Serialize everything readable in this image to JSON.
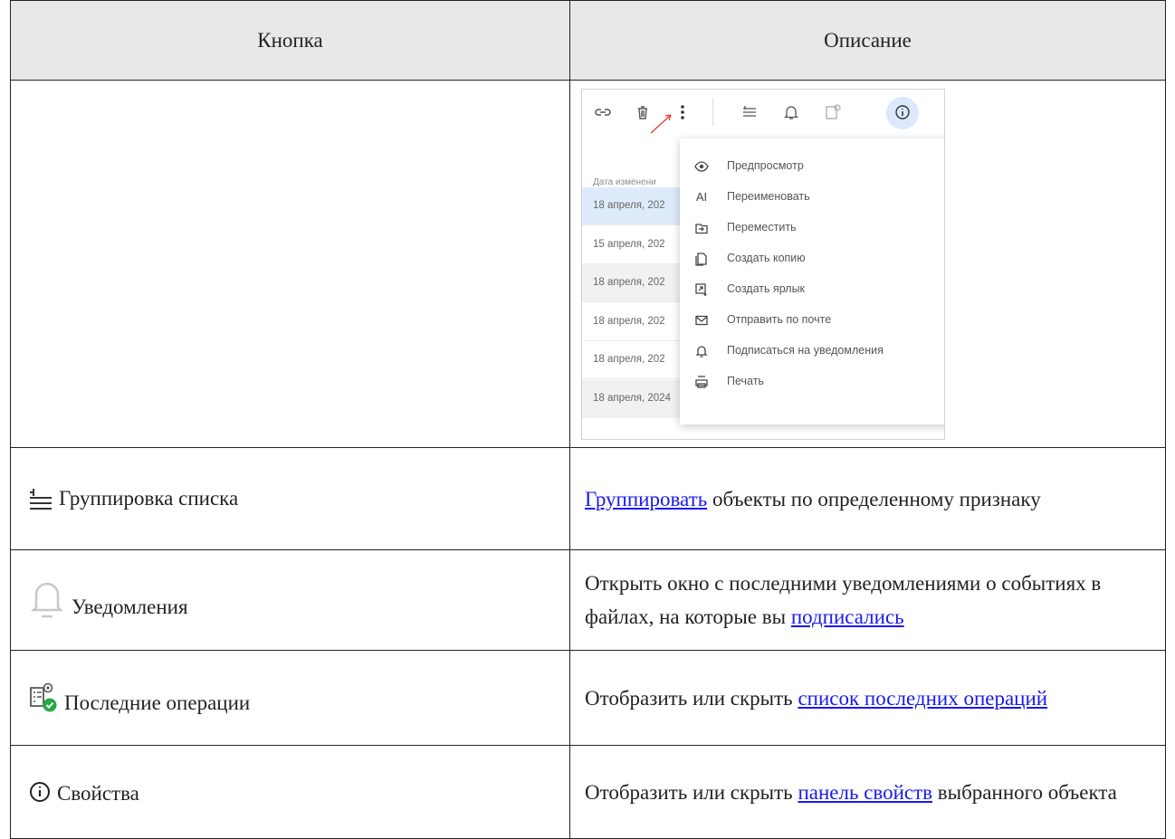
{
  "table": {
    "headers": [
      "Кнопка",
      "Описание"
    ],
    "screenshot": {
      "list_header": "Дата изменени",
      "list_rows": [
        "18 апреля, 202",
        "15 апреля, 202",
        "18 апреля, 202",
        "18 апреля, 202",
        "18 апреля, 202",
        "18 апреля, 2024"
      ],
      "menu": [
        {
          "icon": "eye-icon",
          "label": "Предпросмотр"
        },
        {
          "icon": "rename-icon",
          "label": "Переименовать"
        },
        {
          "icon": "move-icon",
          "label": "Переместить"
        },
        {
          "icon": "copy-icon",
          "label": "Создать копию"
        },
        {
          "icon": "shortcut-icon",
          "label": "Создать ярлык"
        },
        {
          "icon": "mail-icon",
          "label": "Отправить по почте"
        },
        {
          "icon": "bell-icon",
          "label": "Подписаться на уведомления"
        },
        {
          "icon": "print-icon",
          "label": "Печать"
        }
      ]
    },
    "rows": [
      {
        "button": "Группировка списка",
        "icon": "group-list-icon",
        "desc_link": "Группировать",
        "desc_text": " объекты по определенному признаку"
      },
      {
        "button": "Уведомления",
        "icon": "bell-icon",
        "desc_text": "Открыть окно с последними уведомлениями о событиях в файлах, на которые вы ",
        "desc_link": "подписались"
      },
      {
        "button": "Последние операции",
        "icon": "recent-operations-icon",
        "desc_text": "Отобразить или скрыть ",
        "desc_link": "список последних операций"
      },
      {
        "button": "Свойства",
        "icon": "info-icon",
        "desc_text": "Отобразить или скрыть ",
        "desc_link": "панель свойств",
        "desc_text2": " выбранного объекта"
      }
    ]
  }
}
